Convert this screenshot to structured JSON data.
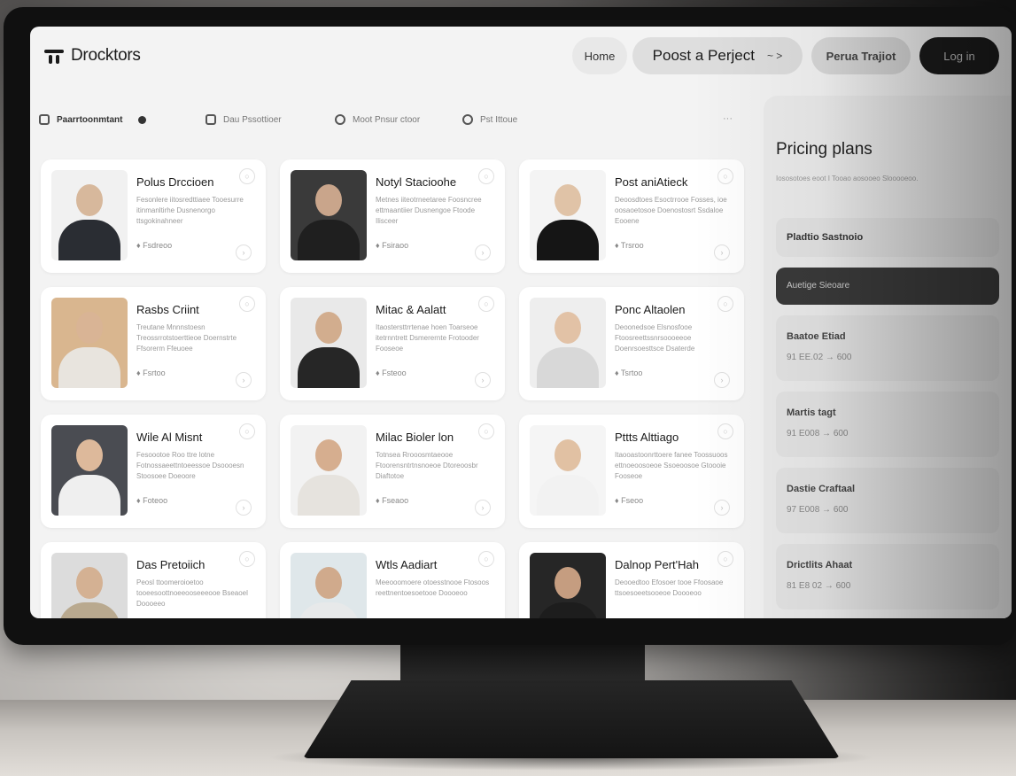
{
  "brand": {
    "name": "Drocktors"
  },
  "nav": {
    "home": "Home",
    "post_project": "Poost a Perject",
    "post_project_arrow": "~ >",
    "review": "Perua Trajiot",
    "login": "Log in"
  },
  "filters": [
    {
      "label": "Paarrtoonmtant",
      "icon": "person-icon"
    },
    {
      "label": "Dau Pssottioer",
      "icon": "image-icon"
    },
    {
      "label": "Moot Pnsur ctoor",
      "icon": "group-icon"
    },
    {
      "label": "Pst Ittoue",
      "icon": "person-icon"
    }
  ],
  "filters_more": "···",
  "cards": [
    {
      "name": "Polus Drccioen",
      "desc": "Fesonlere iitosredttiaee Tooesurre itinmanltirhe Dusnenorgo ttsgokinahneer",
      "meta": "♦ Fsdreoo",
      "skin": "#d7b89c",
      "shirt": "#2a2d33",
      "bg": "#f1f1f1"
    },
    {
      "name": "Notyl Stacioohe",
      "desc": "Metnes iiteotrneetaree Foosncree ettmaantiier Dusnengoe Ftoode Ilisceer",
      "meta": "♦ Fsiraoo",
      "skin": "#c9a58b",
      "shirt": "#1f1f1f",
      "bg": "#3a3a3a"
    },
    {
      "name": "Post aniAtieck",
      "desc": "Deoosdtoes Esoctrrooe Fosses, ioe oosaoetosoe Doenostosrt Ssdaloe Eooene",
      "meta": "♦ Trsroo",
      "skin": "#e0c3a7",
      "shirt": "#151515",
      "bg": "#f4f4f4"
    },
    {
      "name": "Rasbs Criint",
      "desc": "Treutane Mnnnstoesn Treossrrotstoerttieoe Doernstrte Ffsorerm Ffeuoee",
      "meta": "♦ Fsrtoo",
      "skin": "#d9b495",
      "shirt": "#e8e4de",
      "bg": "#d9b68f"
    },
    {
      "name": "Mitac & Aalatt",
      "desc": "Itaostersttrrtenae hoen Toarseoe itetrnntrett Dsmerernte Frotooder Fooseoe",
      "meta": "♦ Fsteoo",
      "skin": "#d2ad8e",
      "shirt": "#262626",
      "bg": "#e9e9e9"
    },
    {
      "name": "Ponc Altaolen",
      "desc": "Deoonedsoe Elsnosfooe Ftoosreettssnrsoooeeoe Doenrsoesttsce Dsaterde",
      "meta": "♦ Tsrtoo",
      "skin": "#e2c2a6",
      "shirt": "#d8d8d8",
      "bg": "#eeeeee"
    },
    {
      "name": "Wile Al Misnt",
      "desc": "Fesoootoe Roo ttre lotne Fotnossaeettntoeessoe Dsoooesn Stoosoee Doeoore",
      "meta": "♦ Foteoo",
      "skin": "#ddb99b",
      "shirt": "#efefef",
      "bg": "#4a4c52"
    },
    {
      "name": "Milac Bioler lon",
      "desc": "Totnsea Rrooosmtaeooe Ftoorensntrtnsnoeoe Dtoreoosbr Diaftotoe",
      "meta": "♦ Fseaoo",
      "skin": "#d6ae8f",
      "shirt": "#e6e3de",
      "bg": "#f2f2f2"
    },
    {
      "name": "Pttts Alttiago",
      "desc": "Itaooastoonrttoere fanee Toossuoos ettnoeoosoeoe Ssoeoosoe Gtoooie Fooseoe",
      "meta": "♦ Fseoo",
      "skin": "#e1c1a3",
      "shirt": "#f2f2f2",
      "bg": "#f5f5f5"
    },
    {
      "name": "Das Pretoiich",
      "desc": "Peosl ttoomeroioetoo tooeesoottnoeeooseeeooe Bseaoel Doooeeo",
      "meta": "",
      "skin": "#d4b193",
      "shirt": "#b9a98f",
      "bg": "#dcdcdc"
    },
    {
      "name": "Wtls Aadiart",
      "desc": "Meeooomoere otoesstnooe Ftosoos reettnentoesoetooe Doooeoo",
      "meta": "",
      "skin": "#d0aa8c",
      "shirt": "#e7e9ea",
      "bg": "#dfe7ea"
    },
    {
      "name": "Dalnop Pert'Hah",
      "desc": "Deooedtoo Efosoer tooe Ffoosaoe ttsoesoeetsooeoe Doooeoo",
      "meta": "",
      "skin": "#c59d80",
      "shirt": "#1d1d1d",
      "bg": "#262626"
    }
  ],
  "pricing": {
    "title": "Pricing plans",
    "subtitle": "Iososotoes eoot I Tooao aosooeo Slooooeoo.",
    "plans": [
      {
        "name": "Pladtio Sastnoio",
        "price": ""
      },
      {
        "name": "Auetige Sieoare",
        "price": ""
      },
      {
        "name": "Baatoe Etiad",
        "price": "91 EE.02 → 600"
      },
      {
        "name": "Martis tagt",
        "price": "91 E008 → 600"
      },
      {
        "name": "Dastie Craftaal",
        "price": "97 E008 → 600"
      },
      {
        "name": "Drictlits Ahaat",
        "price": "81 E8 02 → 600"
      }
    ]
  },
  "colors": {
    "accent_dark": "#1b1b1b",
    "screen_bg": "#f3f3f3",
    "card_bg": "#ffffff"
  }
}
